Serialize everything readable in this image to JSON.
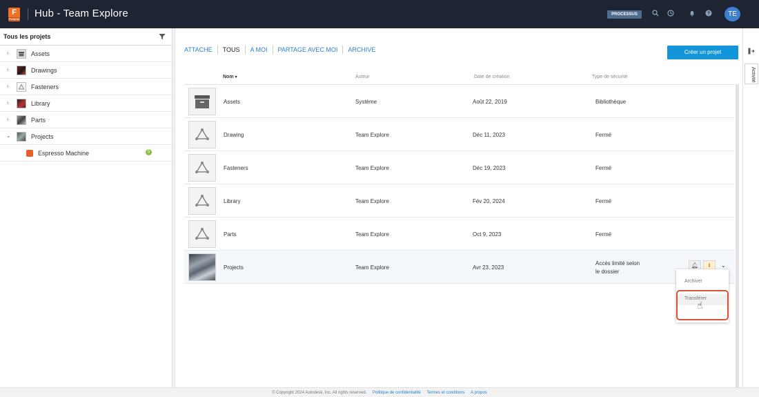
{
  "app": {
    "title": "Hub - Team Explore",
    "logo_letter": "F",
    "logo_sub": "FUSION"
  },
  "topbar": {
    "process_button": "PROCESSUS",
    "avatar": "TE",
    "icons": [
      "search-icon",
      "clock-icon",
      "bell-icon",
      "help-icon"
    ]
  },
  "sidebar": {
    "header": "Tous les projets",
    "items": [
      {
        "label": "Assets",
        "expanded": false
      },
      {
        "label": "Drawings",
        "expanded": false
      },
      {
        "label": "Fasteners",
        "expanded": false
      },
      {
        "label": "Library",
        "expanded": false
      },
      {
        "label": "Parts",
        "expanded": false
      },
      {
        "label": "Projects",
        "expanded": true
      }
    ],
    "subitem": {
      "label": "Espresso Machine",
      "badge": "5"
    }
  },
  "tabs": [
    "ATTACHE",
    "TOUS",
    "A MOI",
    "PARTAGE AVEC MOI",
    "ARCHIVE"
  ],
  "active_tab": "TOUS",
  "create_button": "Créer un projet",
  "table": {
    "headers": {
      "name": "Nom",
      "author": "Auteur",
      "created": "Date de création",
      "security": "Type de sécurité"
    },
    "rows": [
      {
        "name": "Assets",
        "author": "Système",
        "created": "Août 22, 2019",
        "security": "Bibliothèque",
        "thumb": "archive-icon"
      },
      {
        "name": "Drawing",
        "author": "Team Explore",
        "created": "Déc 11, 2023",
        "security": "Fermé",
        "thumb": "project-icon"
      },
      {
        "name": "Fasteners",
        "author": "Team Explore",
        "created": "Déc 19, 2023",
        "security": "Fermé",
        "thumb": "project-icon"
      },
      {
        "name": "Library",
        "author": "Team Explore",
        "created": "Fév 20, 2024",
        "security": "Fermé",
        "thumb": "project-icon"
      },
      {
        "name": "Parts",
        "author": "Team Explore",
        "created": "Oct 9, 2023",
        "security": "Fermé",
        "thumb": "project-icon"
      },
      {
        "name": "Projects",
        "author": "Team Explore",
        "created": "Avr 23, 2023",
        "security_line1": "Accès limité selon",
        "security_line2": "le dossier",
        "thumb": "panel-image"
      }
    ]
  },
  "row_menu": {
    "items": [
      "Archiver",
      "Transférer"
    ],
    "highlighted": "Transférer"
  },
  "rail": {
    "activity_label": "Activité"
  },
  "footer": {
    "copyright": "© Copyright 2024 Autodesk, Inc. All rights reserved.",
    "links": [
      "Politique de confidentialité",
      "Termes et conditions",
      "A propos"
    ]
  },
  "colors": {
    "topbar": "#1f2433",
    "accent": "#1295d8",
    "link": "#2b82c8",
    "highlight_border": "#d9533a"
  }
}
